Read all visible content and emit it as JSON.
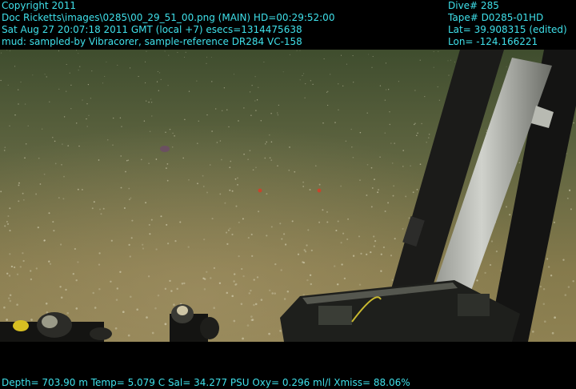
{
  "overlay": {
    "copyright": "Copyright 2011",
    "image_path": "Doc Ricketts\\images\\0285\\00_29_51_00.png (MAIN)  HD=00:29:52:00",
    "timestamp": "Sat Aug 27 20:07:18 2011 GMT (local +7)  esecs=1314475638",
    "sample_note": "mud: sampled-by Vibracorer, sample-reference DR284 VC-158",
    "dive": "Dive# 285",
    "tape": "Tape# D0285-01HD",
    "lat": "Lat= 39.908315 (edited)",
    "lon": "Lon= -124.166221",
    "sensors": "Depth= 703.90 m  Temp= 5.079 C  Sal= 34.277 PSU  Oxy= 0.296 ml/l  Xmiss= 88.06%"
  },
  "colors": {
    "overlay_text": "#3fe0ea",
    "letterbox": "#000000",
    "seafloor_far": "#4b5a35",
    "seafloor_near": "#8a8050"
  }
}
